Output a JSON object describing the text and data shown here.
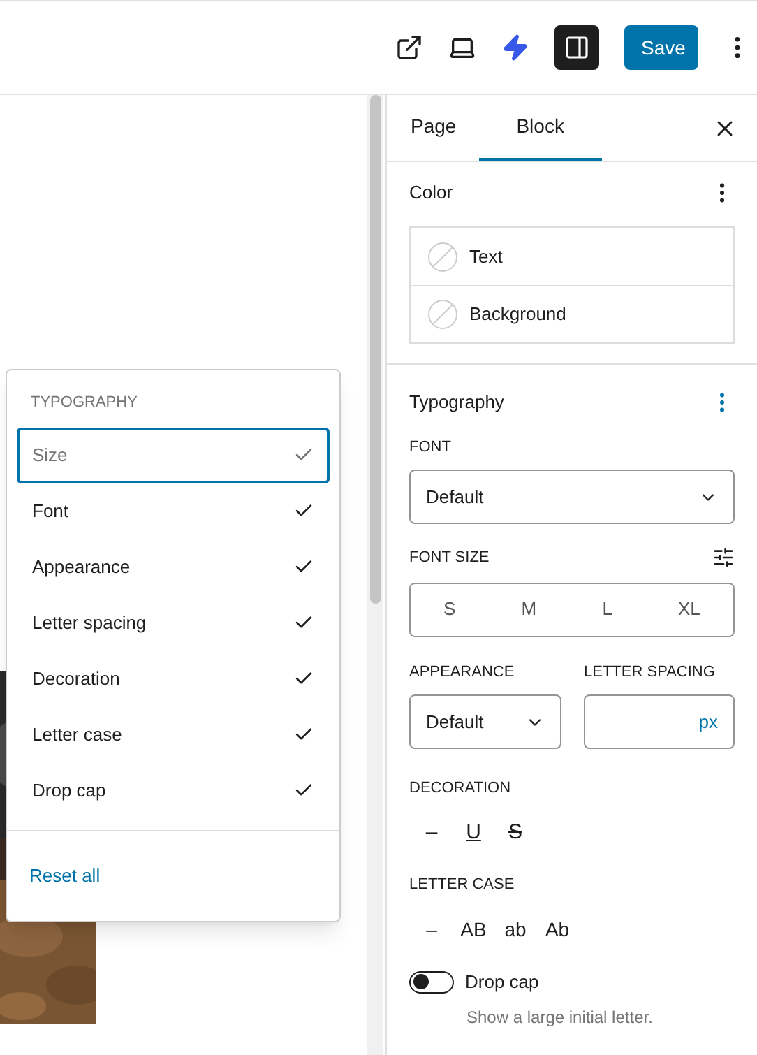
{
  "toolbar": {
    "save": "Save"
  },
  "sidebar": {
    "tabs": [
      {
        "label": "Page",
        "selected": false
      },
      {
        "label": "Block",
        "selected": true
      }
    ],
    "color": {
      "title": "Color",
      "items": [
        "Text",
        "Background"
      ]
    },
    "typography": {
      "title": "Typography",
      "font_label": "FONT",
      "font_value": "Default",
      "font_size_label": "FONT SIZE",
      "sizes": [
        "S",
        "M",
        "L",
        "XL"
      ],
      "appearance_label": "APPEARANCE",
      "appearance_value": "Default",
      "letter_spacing_label": "LETTER SPACING",
      "letter_spacing_unit": "px",
      "decoration_label": "DECORATION",
      "decorations": [
        {
          "kind": "none",
          "label": "–"
        },
        {
          "kind": "underline",
          "label": "U"
        },
        {
          "kind": "strikethrough",
          "label": "S"
        }
      ],
      "letter_case_label": "LETTER CASE",
      "letter_cases": [
        "–",
        "AB",
        "ab",
        "Ab"
      ],
      "drop_cap": {
        "label": "Drop cap",
        "help": "Show a large initial letter.",
        "on": false
      }
    }
  },
  "menu": {
    "title": "TYPOGRAPHY",
    "items": [
      {
        "label": "Size",
        "checked": true,
        "selected": true,
        "disabled": true
      },
      {
        "label": "Font",
        "checked": true,
        "selected": false,
        "disabled": false
      },
      {
        "label": "Appearance",
        "checked": true,
        "selected": false,
        "disabled": false
      },
      {
        "label": "Letter spacing",
        "checked": true,
        "selected": false,
        "disabled": false
      },
      {
        "label": "Decoration",
        "checked": true,
        "selected": false,
        "disabled": false
      },
      {
        "label": "Letter case",
        "checked": true,
        "selected": false,
        "disabled": false
      },
      {
        "label": "Drop cap",
        "checked": true,
        "selected": false,
        "disabled": false
      }
    ],
    "reset": "Reset all"
  }
}
